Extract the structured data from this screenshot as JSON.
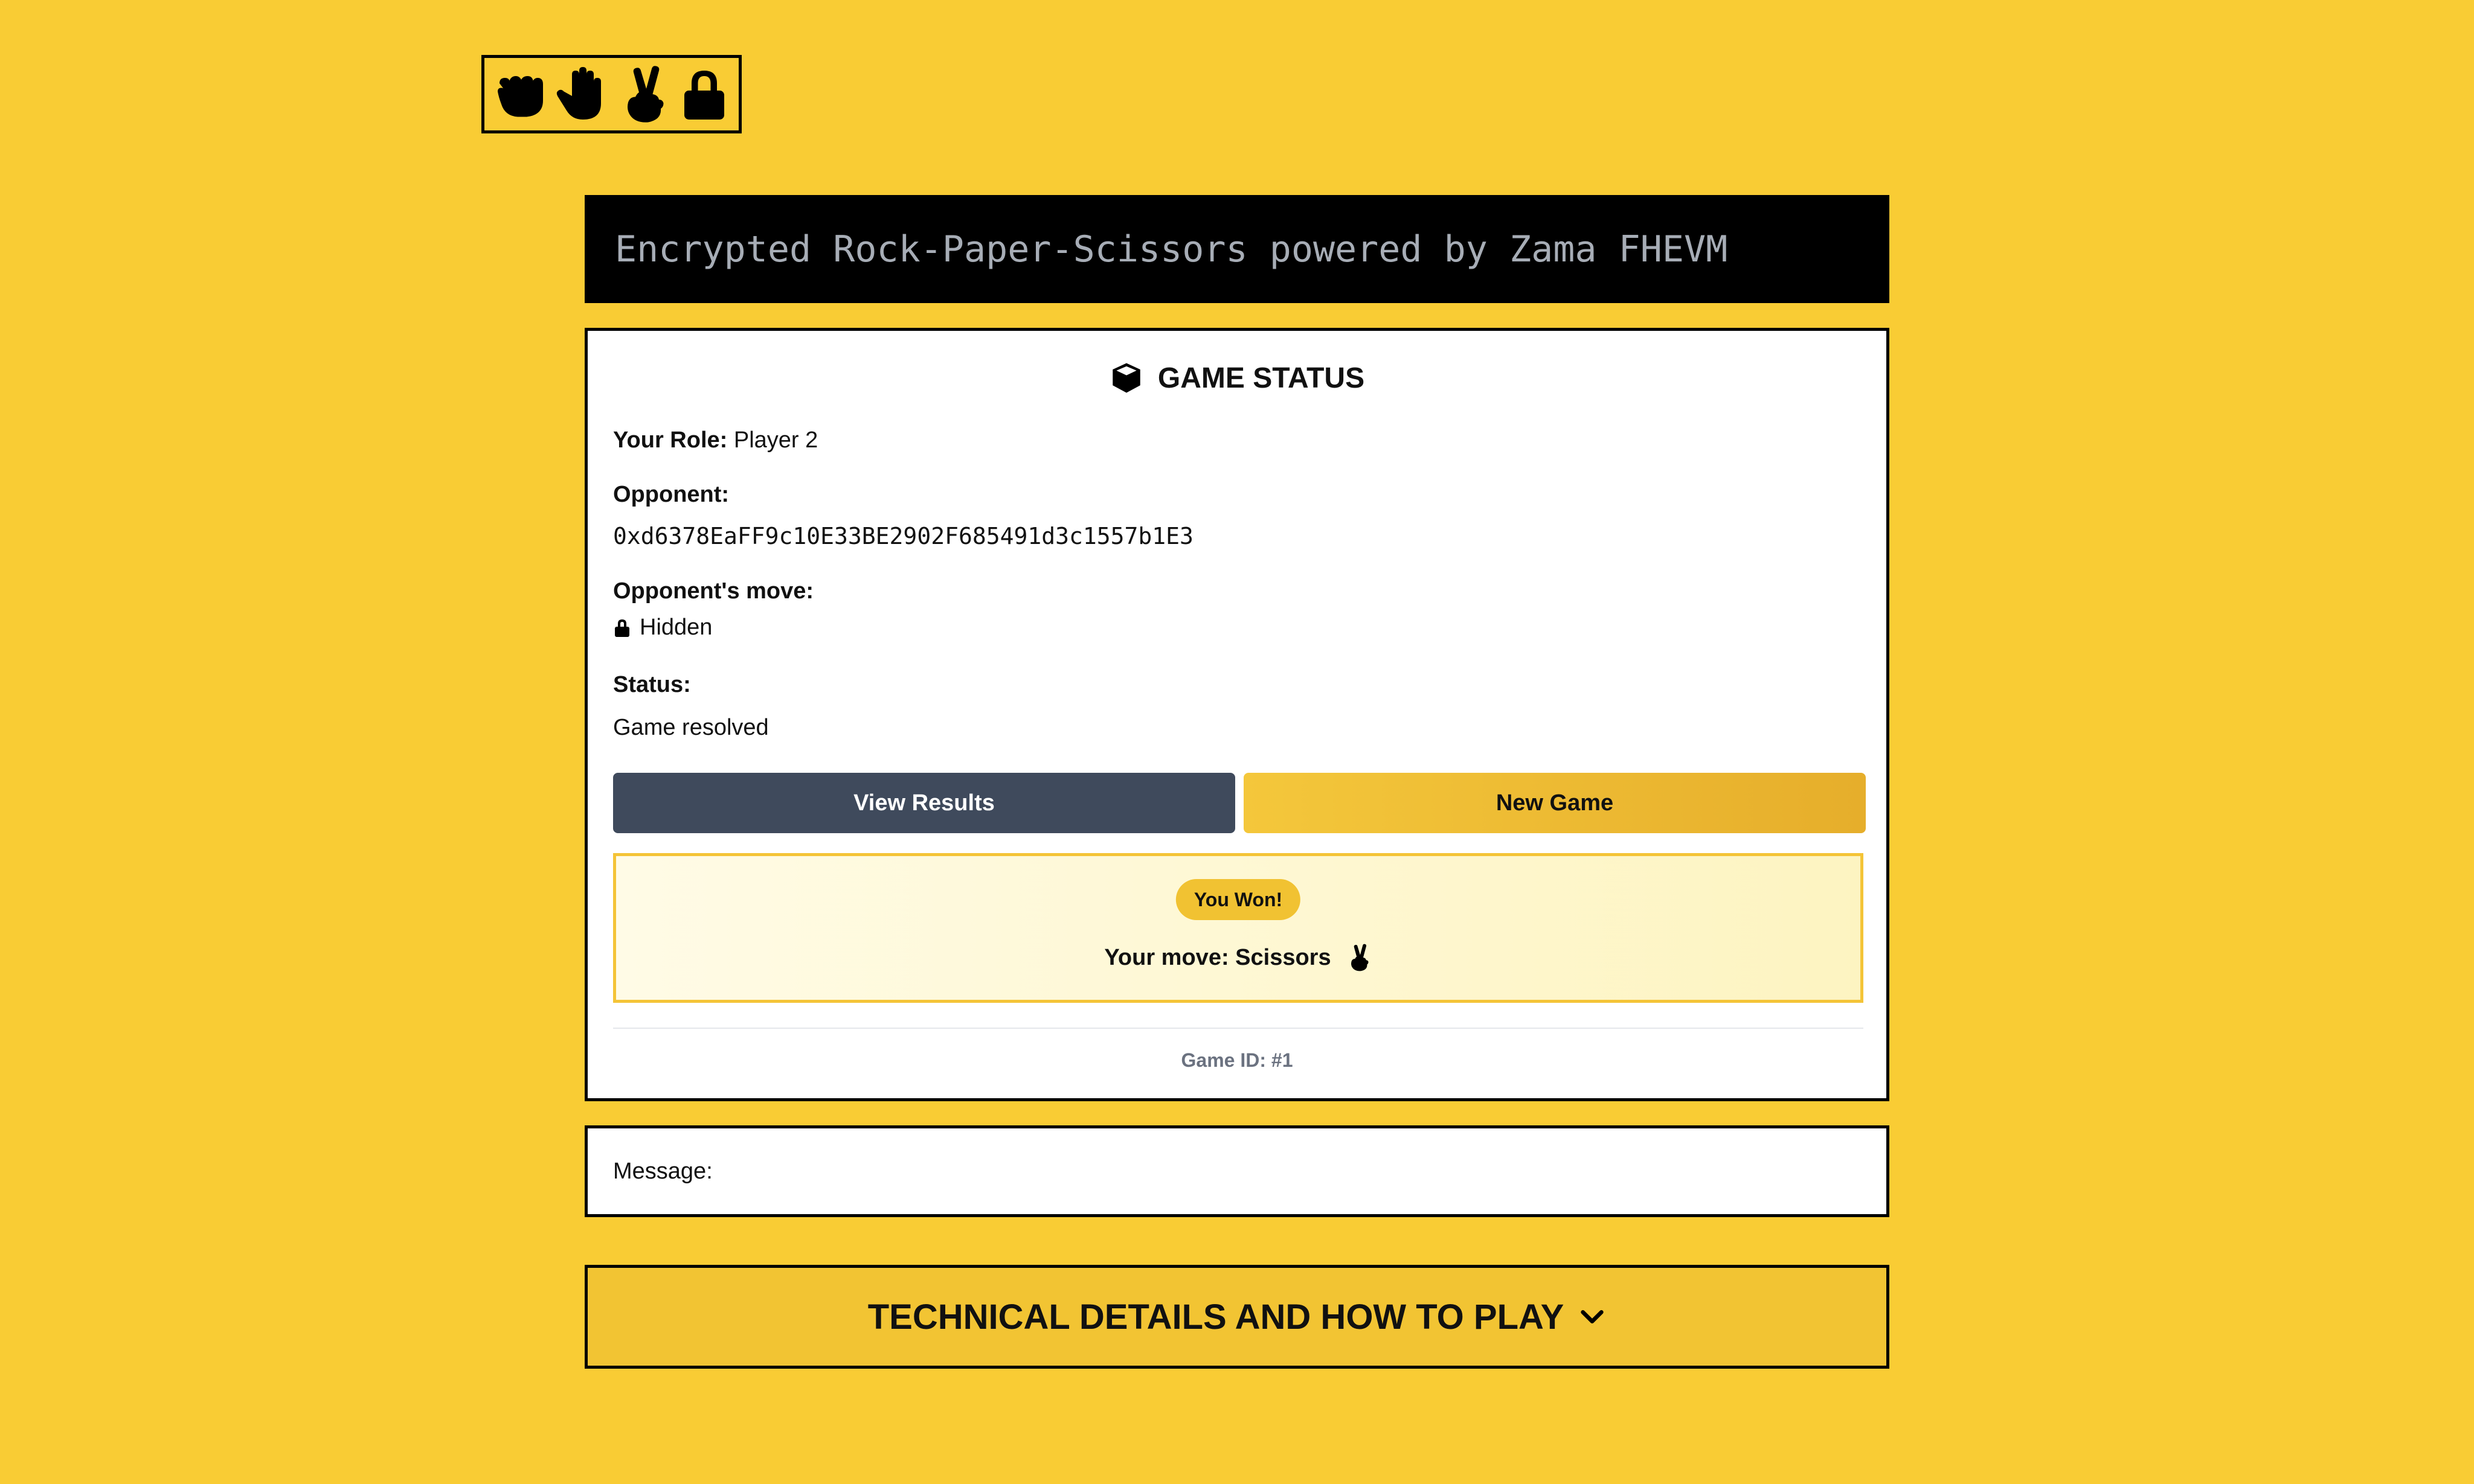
{
  "logo": {
    "icons": [
      "fist-icon",
      "open-hand-icon",
      "victory-hand-icon",
      "lock-icon"
    ]
  },
  "banner": {
    "text": "Encrypted Rock-Paper-Scissors powered by Zama FHEVM"
  },
  "game_status": {
    "title": "GAME STATUS",
    "title_icon": "cube-icon",
    "role_label": "Your Role:",
    "role_value": "Player 2",
    "opponent_label": "Opponent:",
    "opponent_address": "0xd6378EaFF9c10E33BE2902F685491d3c1557b1E3",
    "opponent_move_label": "Opponent's move:",
    "opponent_move_value": "Hidden",
    "status_label": "Status:",
    "status_value": "Game resolved",
    "view_results_label": "View Results",
    "new_game_label": "New Game",
    "result_badge": "You Won!",
    "your_move": "Your move: Scissors",
    "game_id": "Game ID: #1"
  },
  "message": {
    "label": "Message:"
  },
  "technical": {
    "label": "TECHNICAL DETAILS AND HOW TO PLAY"
  },
  "colors": {
    "background": "#F9CC34",
    "banner_bg": "#000000",
    "banner_text": "#A7ADB6",
    "view_button": "#3F4A5C",
    "new_button": "#F4C73B",
    "badge": "#F1C232",
    "result_border": "#F4C437"
  }
}
